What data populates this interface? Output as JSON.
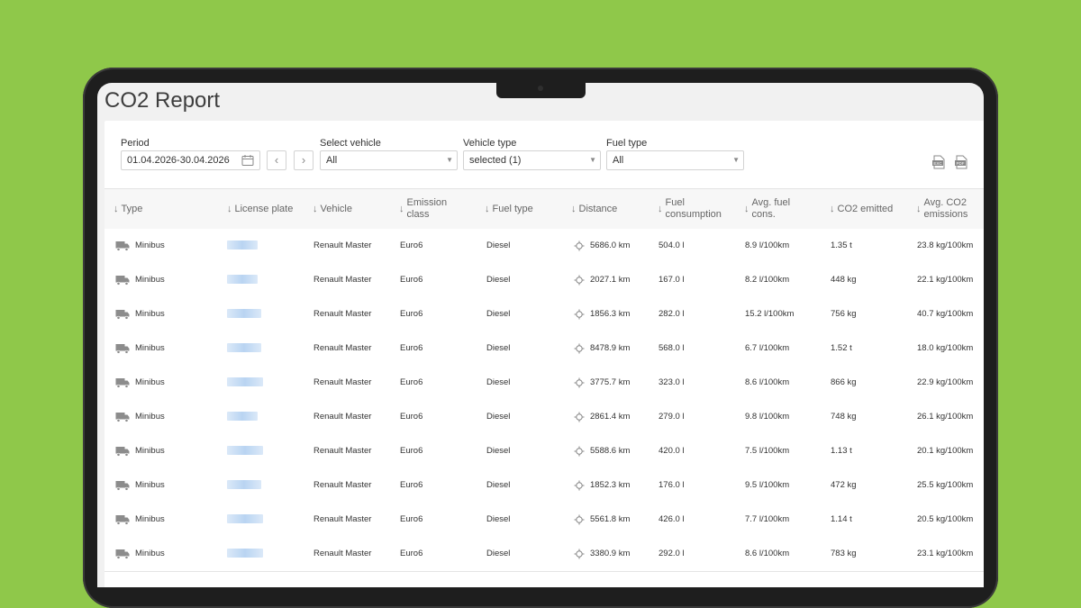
{
  "page": {
    "title": "CO2 Report",
    "background_color": "#8fc84a"
  },
  "filters": {
    "period": {
      "label": "Period",
      "value": "01.04.2026-30.04.2026"
    },
    "vehicle": {
      "label": "Select vehicle",
      "value": "All"
    },
    "vehicle_type": {
      "label": "Vehicle type",
      "value": "selected (1)"
    },
    "fuel_type": {
      "label": "Fuel type",
      "value": "All"
    },
    "prev_icon": "chevron-left-icon",
    "next_icon": "chevron-right-icon"
  },
  "exports": {
    "excel_icon": "excel-export-icon",
    "pdf_icon": "pdf-export-icon"
  },
  "table": {
    "sort_arrow": "↓",
    "columns": {
      "type": "Type",
      "license_plate": "License plate",
      "vehicle": "Vehicle",
      "emission_class": "Emission class",
      "fuel_type": "Fuel type",
      "distance": "Distance",
      "fuel_consumption": "Fuel consumption",
      "avg_fuel": "Avg. fuel cons.",
      "co2": "CO2 emitted",
      "avg_co2": "Avg. CO2 emissions"
    },
    "rows": [
      {
        "type": "Minibus",
        "vehicle": "Renault Master",
        "emission_class": "Euro6",
        "fuel_type": "Diesel",
        "distance": "5686.0 km",
        "fuel_consumption": "504.0 l",
        "avg_fuel": "8.9 l/100km",
        "co2": "1.35 t",
        "avg_co2": "23.8 kg/100km"
      },
      {
        "type": "Minibus",
        "vehicle": "Renault Master",
        "emission_class": "Euro6",
        "fuel_type": "Diesel",
        "distance": "2027.1 km",
        "fuel_consumption": "167.0 l",
        "avg_fuel": "8.2 l/100km",
        "co2": "448 kg",
        "avg_co2": "22.1 kg/100km"
      },
      {
        "type": "Minibus",
        "vehicle": "Renault Master",
        "emission_class": "Euro6",
        "fuel_type": "Diesel",
        "distance": "1856.3 km",
        "fuel_consumption": "282.0 l",
        "avg_fuel": "15.2 l/100km",
        "co2": "756 kg",
        "avg_co2": "40.7 kg/100km"
      },
      {
        "type": "Minibus",
        "vehicle": "Renault Master",
        "emission_class": "Euro6",
        "fuel_type": "Diesel",
        "distance": "8478.9 km",
        "fuel_consumption": "568.0 l",
        "avg_fuel": "6.7 l/100km",
        "co2": "1.52 t",
        "avg_co2": "18.0 kg/100km"
      },
      {
        "type": "Minibus",
        "vehicle": "Renault Master",
        "emission_class": "Euro6",
        "fuel_type": "Diesel",
        "distance": "3775.7 km",
        "fuel_consumption": "323.0 l",
        "avg_fuel": "8.6 l/100km",
        "co2": "866 kg",
        "avg_co2": "22.9 kg/100km"
      },
      {
        "type": "Minibus",
        "vehicle": "Renault Master",
        "emission_class": "Euro6",
        "fuel_type": "Diesel",
        "distance": "2861.4 km",
        "fuel_consumption": "279.0 l",
        "avg_fuel": "9.8 l/100km",
        "co2": "748 kg",
        "avg_co2": "26.1 kg/100km"
      },
      {
        "type": "Minibus",
        "vehicle": "Renault Master",
        "emission_class": "Euro6",
        "fuel_type": "Diesel",
        "distance": "5588.6 km",
        "fuel_consumption": "420.0 l",
        "avg_fuel": "7.5 l/100km",
        "co2": "1.13 t",
        "avg_co2": "20.1 kg/100km"
      },
      {
        "type": "Minibus",
        "vehicle": "Renault Master",
        "emission_class": "Euro6",
        "fuel_type": "Diesel",
        "distance": "1852.3 km",
        "fuel_consumption": "176.0 l",
        "avg_fuel": "9.5 l/100km",
        "co2": "472 kg",
        "avg_co2": "25.5 kg/100km"
      },
      {
        "type": "Minibus",
        "vehicle": "Renault Master",
        "emission_class": "Euro6",
        "fuel_type": "Diesel",
        "distance": "5561.8 km",
        "fuel_consumption": "426.0 l",
        "avg_fuel": "7.7 l/100km",
        "co2": "1.14 t",
        "avg_co2": "20.5 kg/100km"
      },
      {
        "type": "Minibus",
        "vehicle": "Renault Master",
        "emission_class": "Euro6",
        "fuel_type": "Diesel",
        "distance": "3380.9 km",
        "fuel_consumption": "292.0 l",
        "avg_fuel": "8.6 l/100km",
        "co2": "783 kg",
        "avg_co2": "23.1 kg/100km"
      }
    ],
    "row_icons": {
      "type_icon": "truck-icon",
      "distance_icon": "gps-target-icon"
    }
  }
}
